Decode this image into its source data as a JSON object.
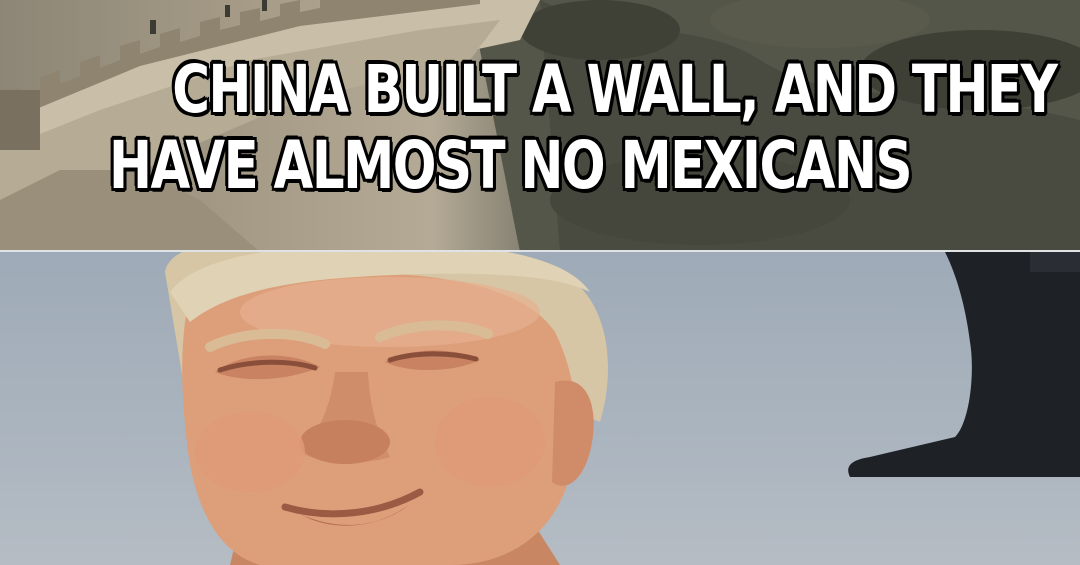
{
  "caption": {
    "line1": "CHINA BUILT A WALL, AND THEY",
    "line2": "HAVE ALMOST NO MEXICANS"
  },
  "colors": {
    "caption_fill": "#ffffff",
    "caption_outline": "#000000",
    "sky": "#a9b4bf",
    "skin": "#d99a76",
    "hair": "#d9c7a8"
  },
  "panels": {
    "top": "great-wall-scene",
    "bottom": "smug-face-scene"
  }
}
